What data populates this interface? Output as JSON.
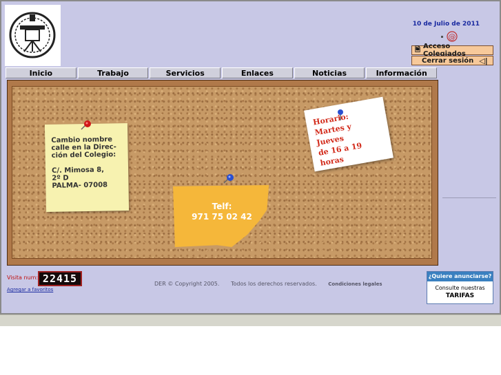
{
  "header": {
    "logo_icon": "college-seal-logo",
    "date": "10 de Julio de 2011",
    "contact_icon": "email-at-icon"
  },
  "account": {
    "login_label": "Acceso Colegiados",
    "login_icon": "document-icon",
    "logout_label": "Cerrar sesión",
    "logout_icon": "back-arrow-icon"
  },
  "nav": {
    "items": [
      {
        "label": "Inicio"
      },
      {
        "label": "Trabajo"
      },
      {
        "label": "Servicios"
      },
      {
        "label": "Enlaces"
      },
      {
        "label": "Noticias"
      },
      {
        "label": "Información"
      }
    ]
  },
  "board": {
    "note_address": {
      "lines": [
        "Cambio nombre",
        "calle en la Direc-",
        "ción del  Colegio:",
        "",
        "C/. Mimosa 8,",
        "2º D",
        "PALMA- 07008"
      ]
    },
    "note_phone": {
      "label": "Telf:",
      "number": "971 75 02 42"
    },
    "note_hours": {
      "title": "Horario:",
      "days": "Martes y Jueves",
      "hours": "de 16 a 19 horas"
    }
  },
  "footer": {
    "visit_label": "Visita num:",
    "visit_count": "22415",
    "favorites_label": "Agregar a favoritos",
    "copyright": "DER © Copyright 2005.",
    "rights": "Todos los derechos reservados.",
    "legal_label": "Condiciones legales"
  },
  "ad": {
    "title": "¿Quiere anunciarse?",
    "text": "Consulte nuestras",
    "link": "TARIFAS"
  },
  "colors": {
    "page_bg": "#c8c8e6",
    "nav_bg": "#d0d0dc",
    "cork": "#c79a66",
    "note_yellow": "#f5b73a",
    "note_pale": "#f7f2b0",
    "hours_text": "#d22a1a",
    "link_blue": "#1a2aa0",
    "ad_title_bg": "#3a80c0"
  }
}
